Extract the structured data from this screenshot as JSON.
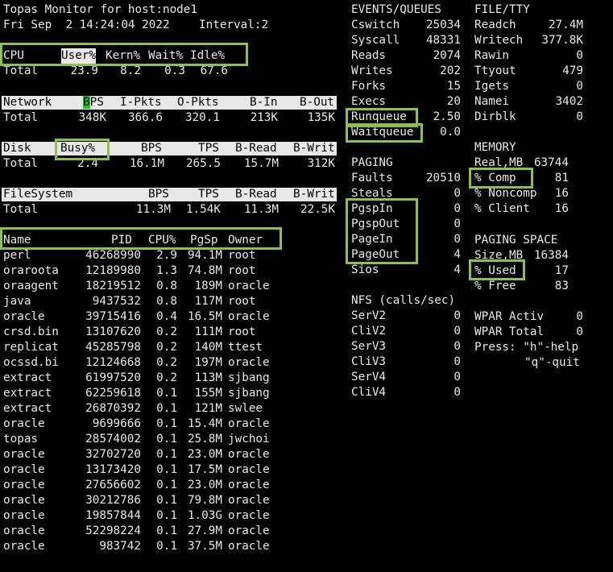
{
  "header": {
    "title": "Topas Monitor for host:node1",
    "datetime": "Fri Sep  2 14:24:04 2022",
    "interval": "Interval:2"
  },
  "cpu": {
    "label": "CPU",
    "col_user": "User%",
    "col_kern": "Kern%",
    "col_wait": "Wait%",
    "col_idle": "Idle%",
    "total_label": "Total",
    "user": "23.9",
    "kern": "8.2",
    "wait": "0.3",
    "idle": "67.6"
  },
  "network": {
    "label": "Network",
    "col_bps_cursor": "B",
    "col_bps_rest": "PS",
    "col_ipkts": "I-Pkts",
    "col_opkts": "O-Pkts",
    "col_bin": "B-In",
    "col_bout": "B-Out",
    "total_label": "Total",
    "bps": "348K",
    "ipkts": "366.6",
    "opkts": "320.1",
    "bin": "213K",
    "bout": "135K"
  },
  "disk": {
    "label": "Disk",
    "col_busy": "Busy%",
    "col_bps": "BPS",
    "col_tps": "TPS",
    "col_bread": "B-Read",
    "col_bwrit": "B-Writ",
    "total_label": "Total",
    "busy": "2.4",
    "bps": "16.1M",
    "tps": "265.5",
    "bread": "15.7M",
    "bwrit": "312K"
  },
  "filesystem": {
    "label": "FileSystem",
    "col_bps": "BPS",
    "col_tps": "TPS",
    "col_bread": "B-Read",
    "col_bwrit": "B-Writ",
    "total_label": "Total",
    "bps": "11.3M",
    "tps": "1.54K",
    "bread": "11.3M",
    "bwrit": "22.5K"
  },
  "processes": {
    "col_name": "Name",
    "col_pid": "PID",
    "col_cpu": "CPU%",
    "col_pgsp": "PgSp",
    "col_owner": "Owner",
    "rows": [
      {
        "name": "perl",
        "pid": "46268990",
        "cpu": "2.9",
        "pgsp": "94.1M",
        "owner": "root"
      },
      {
        "name": "oraroota",
        "pid": "12189980",
        "cpu": "1.3",
        "pgsp": "74.8M",
        "owner": "root"
      },
      {
        "name": "oraagent",
        "pid": "18219512",
        "cpu": "0.8",
        "pgsp": "189M",
        "owner": "oracle"
      },
      {
        "name": "java",
        "pid": "9437532",
        "cpu": "0.8",
        "pgsp": "117M",
        "owner": "root"
      },
      {
        "name": "oracle",
        "pid": "39715416",
        "cpu": "0.4",
        "pgsp": "16.5M",
        "owner": "oracle"
      },
      {
        "name": "crsd.bin",
        "pid": "13107620",
        "cpu": "0.2",
        "pgsp": "111M",
        "owner": "root"
      },
      {
        "name": "replicat",
        "pid": "45285798",
        "cpu": "0.2",
        "pgsp": "140M",
        "owner": "ttest"
      },
      {
        "name": "ocssd.bi",
        "pid": "12124668",
        "cpu": "0.2",
        "pgsp": "197M",
        "owner": "oracle"
      },
      {
        "name": "extract",
        "pid": "61997520",
        "cpu": "0.2",
        "pgsp": "113M",
        "owner": "sjbang"
      },
      {
        "name": "extract",
        "pid": "62259618",
        "cpu": "0.1",
        "pgsp": "155M",
        "owner": "sjbang"
      },
      {
        "name": "extract",
        "pid": "26870392",
        "cpu": "0.1",
        "pgsp": "121M",
        "owner": "swlee"
      },
      {
        "name": "oracle",
        "pid": "9699666",
        "cpu": "0.1",
        "pgsp": "15.4M",
        "owner": "oracle"
      },
      {
        "name": "topas",
        "pid": "28574002",
        "cpu": "0.1",
        "pgsp": "25.8M",
        "owner": "jwchoi"
      },
      {
        "name": "oracle",
        "pid": "32702720",
        "cpu": "0.1",
        "pgsp": "23.0M",
        "owner": "oracle"
      },
      {
        "name": "oracle",
        "pid": "13173420",
        "cpu": "0.1",
        "pgsp": "17.5M",
        "owner": "oracle"
      },
      {
        "name": "oracle",
        "pid": "27656602",
        "cpu": "0.1",
        "pgsp": "23.0M",
        "owner": "oracle"
      },
      {
        "name": "oracle",
        "pid": "30212786",
        "cpu": "0.1",
        "pgsp": "79.8M",
        "owner": "oracle"
      },
      {
        "name": "oracle",
        "pid": "19857844",
        "cpu": "0.1",
        "pgsp": "1.03G",
        "owner": "oracle"
      },
      {
        "name": "oracle",
        "pid": "52298224",
        "cpu": "0.1",
        "pgsp": "27.9M",
        "owner": "oracle"
      },
      {
        "name": "oracle",
        "pid": "983742",
        "cpu": "0.1",
        "pgsp": "37.5M",
        "owner": "oracle"
      }
    ]
  },
  "events": {
    "title": "EVENTS/QUEUES",
    "items": [
      {
        "label": "Cswitch",
        "value": "25034"
      },
      {
        "label": "Syscall",
        "value": "48331"
      },
      {
        "label": "Reads",
        "value": "2074"
      },
      {
        "label": "Writes",
        "value": "202"
      },
      {
        "label": "Forks",
        "value": "15"
      },
      {
        "label": "Execs",
        "value": "20"
      },
      {
        "label": "Runqueue",
        "value": "2.50"
      },
      {
        "label": "Waitqueue",
        "value": "0.0"
      }
    ]
  },
  "paging": {
    "title": "PAGING",
    "items": [
      {
        "label": "Faults",
        "value": "20510"
      },
      {
        "label": "Steals",
        "value": "0"
      },
      {
        "label": "PgspIn",
        "value": "0"
      },
      {
        "label": "PgspOut",
        "value": "0"
      },
      {
        "label": "PageIn",
        "value": "0"
      },
      {
        "label": "PageOut",
        "value": "4"
      },
      {
        "label": "Sios",
        "value": "4"
      }
    ]
  },
  "nfs": {
    "title": "NFS (calls/sec)",
    "items": [
      {
        "label": "SerV2",
        "value": "0"
      },
      {
        "label": "CliV2",
        "value": "0"
      },
      {
        "label": "SerV3",
        "value": "0"
      },
      {
        "label": "CliV3",
        "value": "0"
      },
      {
        "label": "SerV4",
        "value": "0"
      },
      {
        "label": "CliV4",
        "value": "0"
      }
    ]
  },
  "filetty": {
    "title": "FILE/TTY",
    "items": [
      {
        "label": "Readch",
        "value": "27.4M"
      },
      {
        "label": "Writech",
        "value": "377.8K"
      },
      {
        "label": "Rawin",
        "value": "0"
      },
      {
        "label": "Ttyout",
        "value": "479"
      },
      {
        "label": "Igets",
        "value": "0"
      },
      {
        "label": "Namei",
        "value": "3402"
      },
      {
        "label": "Dirblk",
        "value": "0"
      }
    ]
  },
  "memory": {
    "title": "MEMORY",
    "items": [
      {
        "label": "Real,MB",
        "value": "63744"
      },
      {
        "label": "% Comp",
        "value": "81"
      },
      {
        "label": "% Noncomp",
        "value": "16"
      },
      {
        "label": "% Client",
        "value": "16"
      }
    ]
  },
  "paging_space": {
    "title": "PAGING SPACE",
    "items": [
      {
        "label": "Size,MB",
        "value": "16384"
      },
      {
        "label": "% Used",
        "value": "17"
      },
      {
        "label": "% Free",
        "value": "83"
      }
    ]
  },
  "wpar": {
    "activ_label": "WPAR Activ",
    "activ_value": "0",
    "total_label": "WPAR Total",
    "total_value": "0"
  },
  "help": {
    "line1": "Press: \"h\"-help",
    "line2": "\"q\"-quit"
  },
  "colors": {
    "background": "#000000",
    "text": "#e8e8e8",
    "header_bar": "#e8e8e8",
    "highlight_box": "#8bc34a",
    "cursor": "#19c819"
  }
}
